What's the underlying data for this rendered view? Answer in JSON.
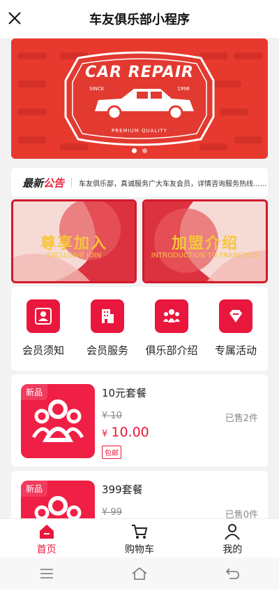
{
  "app": {
    "title": "车友俱乐部小程序"
  },
  "banner": {
    "title": "CAR REPAIR",
    "since_left": "SINCE",
    "since_right": "1998",
    "subtitle": "PREMIUM QUALITY",
    "slide_count": 2,
    "active_slide": 0
  },
  "notice": {
    "badge_part1": "最新",
    "badge_part2": "公告",
    "text": "车友俱乐部，真诚服务广大车友会员，详情咨询服务热线......"
  },
  "promos": [
    {
      "title": "尊享加入",
      "subtitle": "EXCLUSIVE JOIN"
    },
    {
      "title": "加盟介绍",
      "subtitle": "INTRODUCTION TO FRANCHISE"
    }
  ],
  "menu": [
    {
      "label": "会员须知",
      "icon": "person-icon"
    },
    {
      "label": "会员服务",
      "icon": "building-icon"
    },
    {
      "label": "俱乐部介绍",
      "icon": "group-icon"
    },
    {
      "label": "专属活动",
      "icon": "diamond-icon"
    }
  ],
  "products": [
    {
      "tag": "新品",
      "name": "10元套餐",
      "orig_price": "¥ 10",
      "sold": "已售2件",
      "currency": "¥",
      "price": "10.00",
      "ship": "包邮"
    },
    {
      "tag": "新品",
      "name": "399套餐",
      "orig_price": "¥ 99",
      "sold": "已售0件"
    }
  ],
  "tabs": [
    {
      "label": "首页",
      "icon": "home-icon",
      "active": true
    },
    {
      "label": "购物车",
      "icon": "cart-icon",
      "active": false
    },
    {
      "label": "我的",
      "icon": "user-icon",
      "active": false
    }
  ],
  "colors": {
    "accent": "#e8173c",
    "banner": "#e8392f",
    "promo_border": "#d3192c",
    "gold": "#f7c63a"
  }
}
